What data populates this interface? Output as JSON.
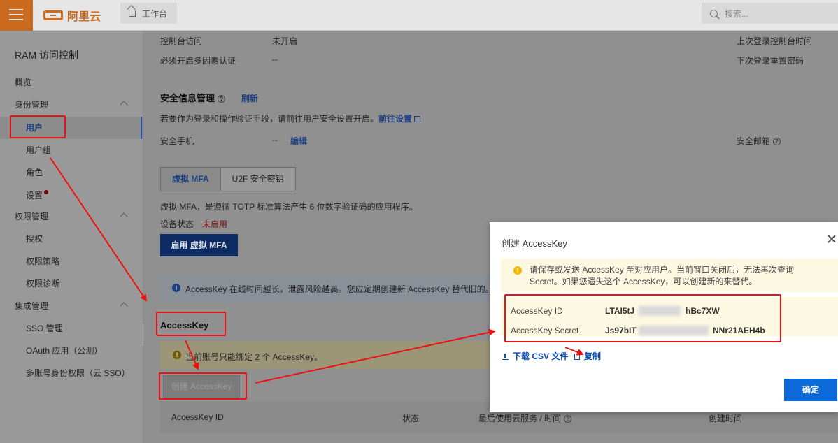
{
  "topbar": {
    "brand": "阿里云",
    "workbench": "工作台",
    "search_placeholder": "搜索..."
  },
  "sidebar": {
    "title": "RAM 访问控制",
    "overview": "概览",
    "identity_group": "身份管理",
    "users": "用户",
    "user_groups": "用户组",
    "roles": "角色",
    "settings": "设置",
    "permission_group": "权限管理",
    "grant": "授权",
    "policies": "权限策略",
    "diagnosis": "权限诊断",
    "integration_group": "集成管理",
    "sso": "SSO 管理",
    "oauth": "OAuth 应用（公测）",
    "multi_account": "多账号身份权限（云 SSO）"
  },
  "main": {
    "console_access_label": "控制台访问",
    "console_access_value": "未开启",
    "last_login_label": "上次登录控制台时间",
    "mfa_required_label": "必须开启多因素认证",
    "mfa_required_value": "--",
    "next_reset_label": "下次登录重置密码",
    "security_title": "安全信息管理",
    "refresh": "刷新",
    "security_desc": "若要作为登录和操作验证手段，请前往用户安全设置开启。",
    "goto_settings": "前往设置",
    "phone_label": "安全手机",
    "phone_value": "--",
    "edit": "编辑",
    "email_label": "安全邮箱",
    "tab_virtual_mfa": "虚拟 MFA",
    "tab_u2f": "U2F 安全密钥",
    "mfa_desc": "虚拟 MFA，是遵循 TOTP 标准算法产生 6 位数字验证码的应用程序。",
    "device_status_label": "设备状态",
    "device_status_value": "未启用",
    "enable_mfa": "启用 虚拟 MFA",
    "info_text": "AccessKey 在线时间越长，泄露风险越高。您应定期创建新 AccessKey 替代旧的。 ",
    "ak_title": "AccessKey",
    "warn_text": "当前账号只能绑定 2 个 AccessKey。",
    "create_ak": "创建 AccessKey",
    "col_ak_id": "AccessKey ID",
    "col_status": "状态",
    "col_last_used": "最后使用云服务 / 时间",
    "col_created": "创建时间"
  },
  "modal": {
    "title": "创建 AccessKey",
    "warning": "请保存或发送 AccessKey 至对应用户。当前窗口关闭后，无法再次查询 Secret。如果您遗失这个 AccessKey，可以创建新的来替代。",
    "id_label": "AccessKey ID",
    "id_prefix": "LTAI5tJ",
    "id_suffix": "hBc7XW",
    "secret_label": "AccessKey Secret",
    "secret_prefix": "Js97bIT",
    "secret_suffix": "NNr21AEH4b",
    "download_csv": "下载 CSV 文件",
    "copy": "复制",
    "ok": "确定"
  },
  "colors": {
    "accent_blue": "#0d6ad9",
    "annotation_red": "#ee1111",
    "brand_orange": "#c96a1f"
  }
}
